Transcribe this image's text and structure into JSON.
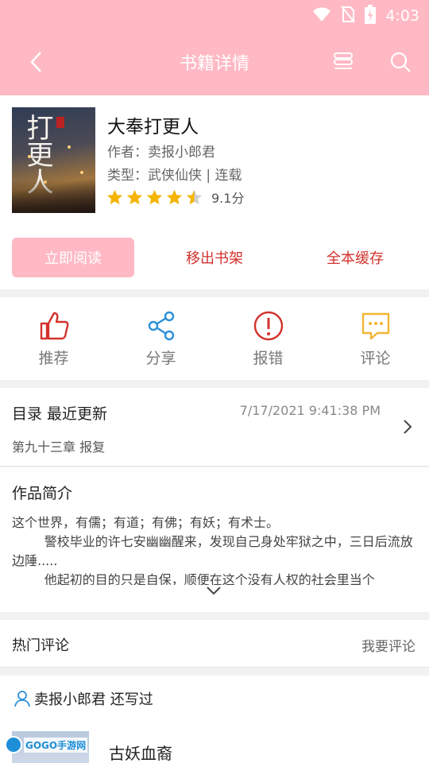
{
  "status_bar": {
    "time": "4:03",
    "icons": [
      "wifi-icon",
      "no-sim-icon",
      "battery-charging-icon"
    ]
  },
  "header": {
    "title": "书籍详情",
    "back_icon": "chevron-left-icon",
    "layout_icon": "layout-icon",
    "search_icon": "search-icon",
    "color": "#ffb9c4"
  },
  "book": {
    "name": "大奉打更人",
    "author": "作者：卖报小郎君",
    "type": "类型：武侠仙侠 | 连载",
    "score": "9.1分",
    "stars": 4.5,
    "cover_text": "打更人"
  },
  "buttons": {
    "read": "立即阅读",
    "remove": "移出书架",
    "cache": "全本缓存"
  },
  "actions": [
    {
      "label": "推荐",
      "icon": "thumbs-up-icon",
      "color": "#d2322d"
    },
    {
      "label": "分享",
      "icon": "share-icon",
      "color": "#2b90d9"
    },
    {
      "label": "报错",
      "icon": "alert-icon",
      "color": "#d2322d"
    },
    {
      "label": "评论",
      "icon": "comment-icon",
      "color": "#f2b632"
    }
  ],
  "toc": {
    "title": "目录  最近更新",
    "time": "7/17/2021 9:41:38 PM",
    "chapter": "第九十三章 报复"
  },
  "intro": {
    "title": "作品简介",
    "lines": [
      "这个世界，有儒；有道；有佛；有妖；有术士。",
      "        警校毕业的许七安幽幽醒来，发现自己身处牢狱之中，三日后流放边陲.....",
      "        他起初的目的只是自保，顺便在这个没有人权的社会里当个"
    ]
  },
  "hot_comments": {
    "title": "热门评论",
    "write": "我要评论"
  },
  "also_wrote": {
    "title": "卖报小郎君 还写过",
    "book": "古妖血裔"
  },
  "watermark": "GOGO手游网"
}
